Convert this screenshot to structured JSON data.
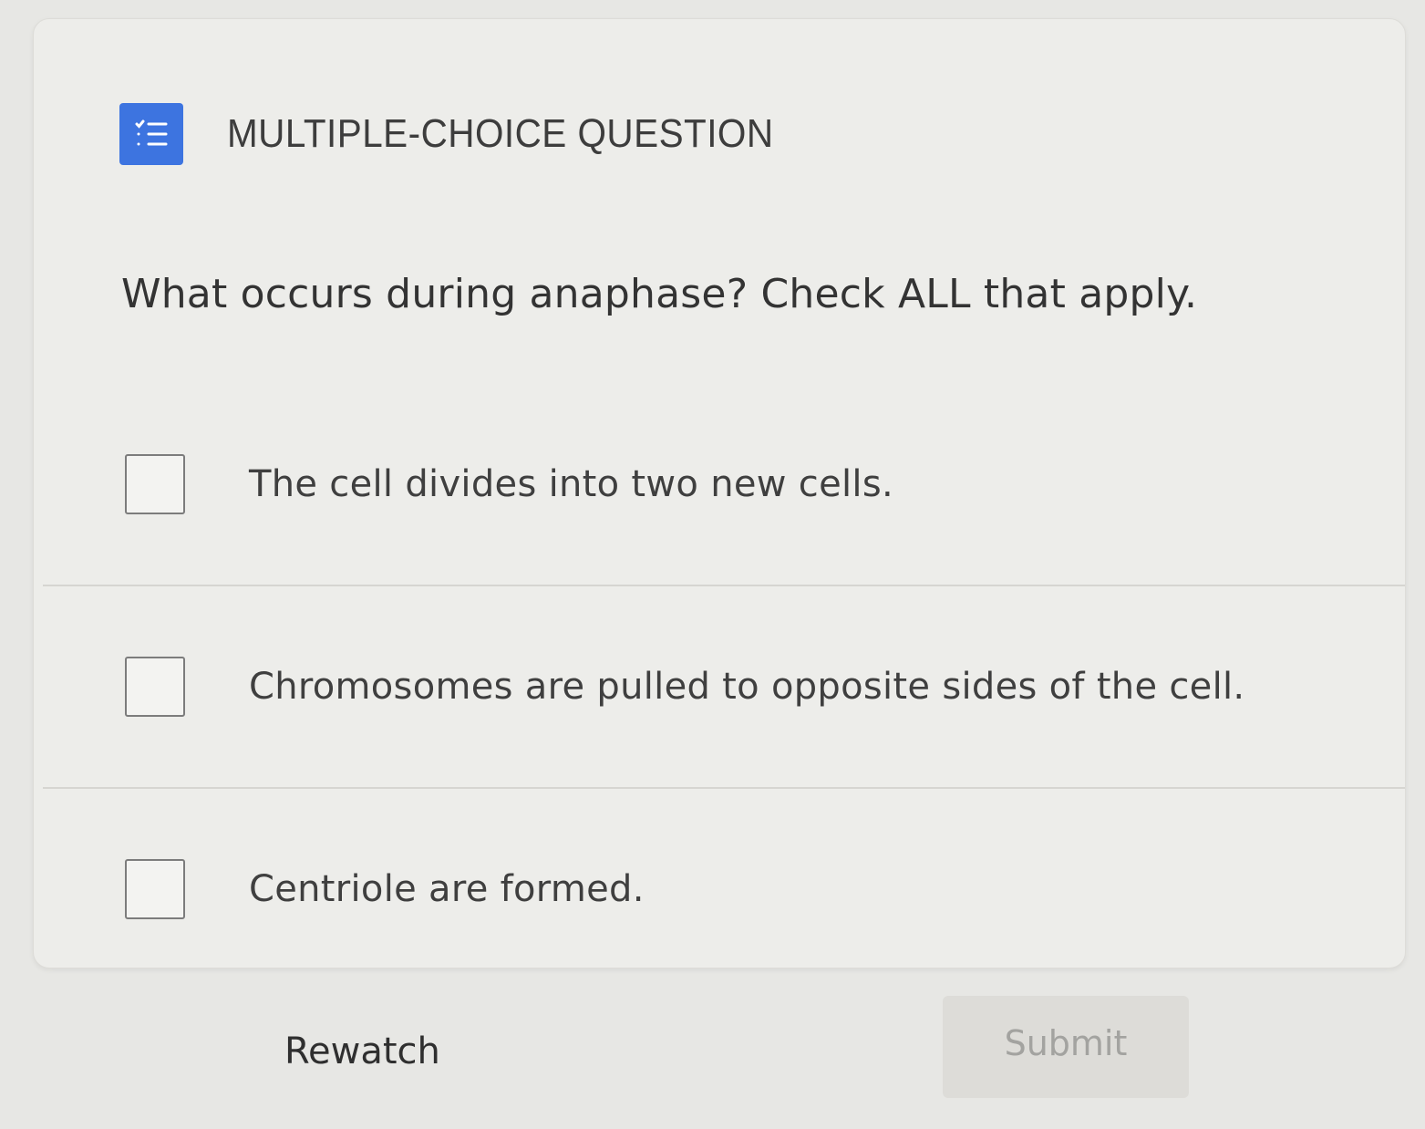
{
  "header": {
    "type_icon": "checklist-icon",
    "type_label": "MULTIPLE-CHOICE QUESTION",
    "icon_color": "#3d74e0"
  },
  "question": {
    "text": "What occurs during anaphase? Check ALL that apply."
  },
  "options": [
    {
      "label": "The cell divides into two new cells.",
      "checked": false
    },
    {
      "label": "Chromosomes are pulled to opposite sides of the cell.",
      "checked": false
    },
    {
      "label": "Centriole are formed.",
      "checked": false
    }
  ],
  "actions": {
    "rewatch_label": "Rewatch",
    "submit_label": "Submit",
    "submit_enabled": false
  }
}
